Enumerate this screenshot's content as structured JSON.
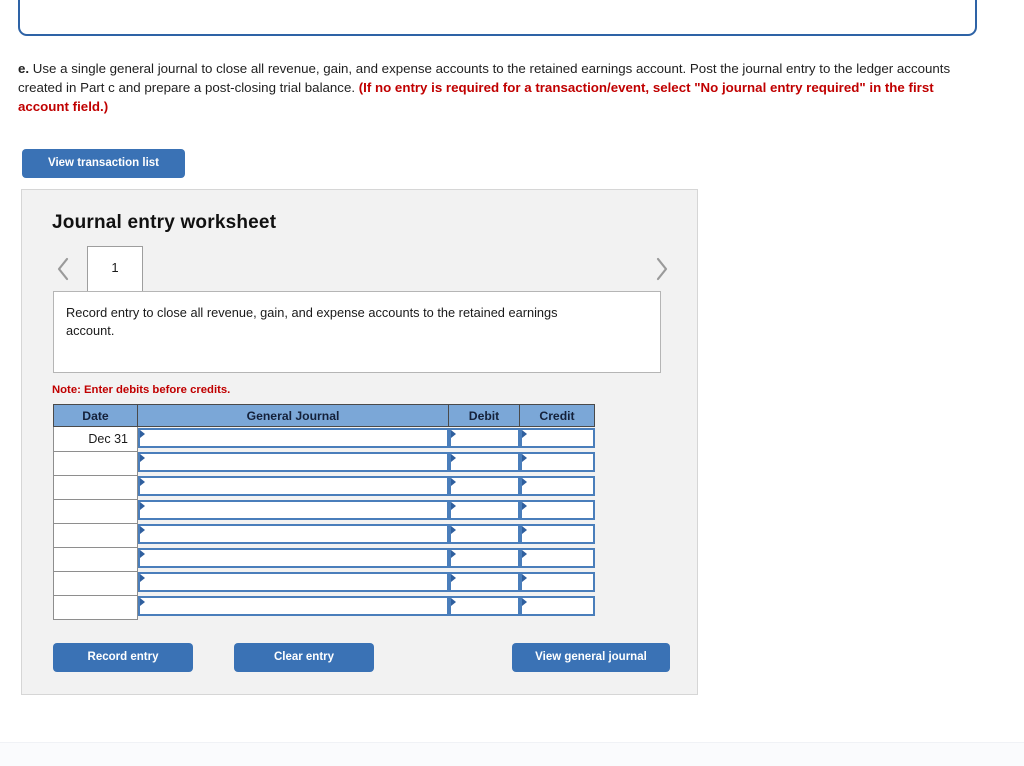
{
  "top_panel": {
    "content": ""
  },
  "prompt": {
    "lead": "e.",
    "body": " Use a single general journal to close all revenue, gain, and expense accounts to the retained earnings account. Post the journal entry to the ledger accounts created in Part c and prepare a post-closing trial balance. ",
    "requirement": "(If no entry is required for a transaction/event, select \"No journal entry required\" in the first account field.)"
  },
  "toolbar": {
    "view_transaction_list_label": "View transaction list"
  },
  "worksheet": {
    "title": "Journal entry worksheet",
    "pager": {
      "prev_icon": "chevron-left-icon",
      "next_icon": "chevron-right-icon",
      "current_tab": "1"
    },
    "description": "Record entry to close all revenue, gain, and expense accounts to the retained earnings account.",
    "note": "Note: Enter debits before credits.",
    "table": {
      "columns": [
        "Date",
        "General Journal",
        "Debit",
        "Credit"
      ],
      "rows": [
        {
          "date": "Dec 31",
          "account": "",
          "debit": "",
          "credit": ""
        },
        {
          "date": "",
          "account": "",
          "debit": "",
          "credit": ""
        },
        {
          "date": "",
          "account": "",
          "debit": "",
          "credit": ""
        },
        {
          "date": "",
          "account": "",
          "debit": "",
          "credit": ""
        },
        {
          "date": "",
          "account": "",
          "debit": "",
          "credit": ""
        },
        {
          "date": "",
          "account": "",
          "debit": "",
          "credit": ""
        },
        {
          "date": "",
          "account": "",
          "debit": "",
          "credit": ""
        },
        {
          "date": "",
          "account": "",
          "debit": "",
          "credit": ""
        }
      ]
    },
    "actions": {
      "record_entry_label": "Record entry",
      "clear_entry_label": "Clear entry",
      "view_general_journal_label": "View general journal"
    }
  },
  "colors": {
    "button_blue": "#3a72b5",
    "table_header_blue": "#7ba7d7",
    "input_border_blue": "#4a7ebb",
    "note_red": "#c00000",
    "panel_gray": "#f2f2f2",
    "top_panel_border": "#2e63a6"
  }
}
